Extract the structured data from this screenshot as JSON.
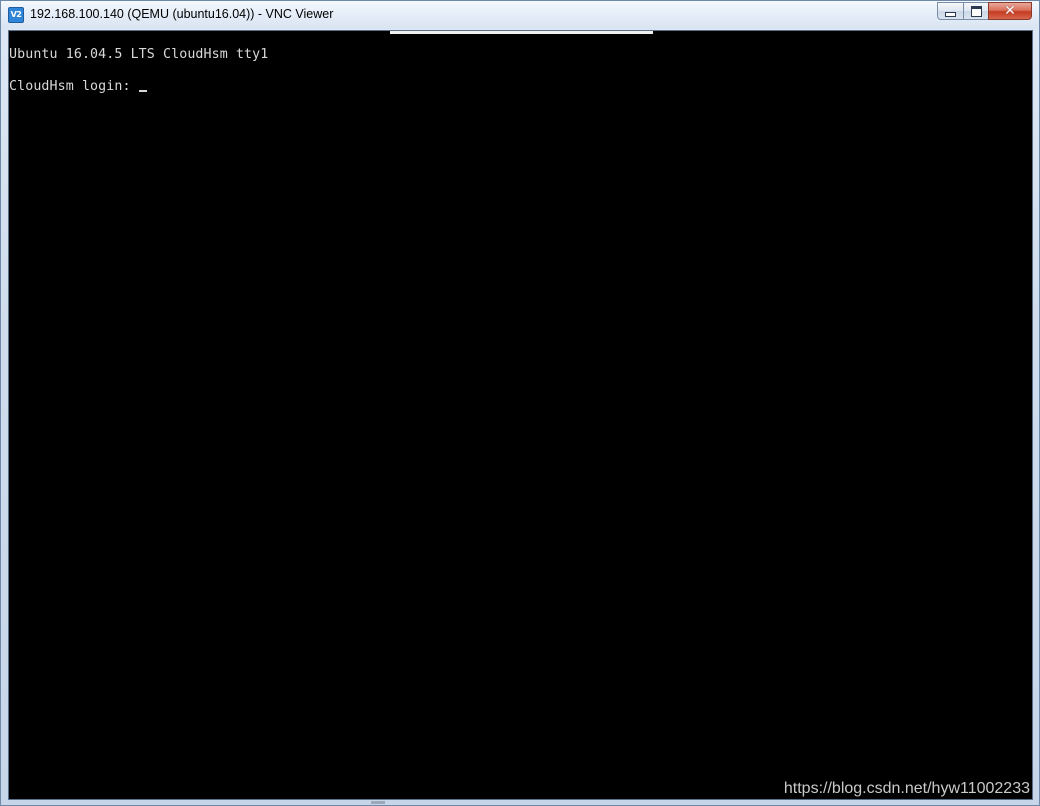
{
  "window": {
    "title": "192.168.100.140 (QEMU (ubuntu16.04)) - VNC Viewer",
    "app_icon": "vnc-viewer-icon",
    "app_icon_text": "V2",
    "controls": {
      "minimize_icon": "minimize-icon",
      "maximize_icon": "restore-icon",
      "close_icon": "close-icon",
      "close_glyph": "✕"
    }
  },
  "console": {
    "banner": "Ubuntu 16.04.5 LTS CloudHsm tty1",
    "login_prompt": "CloudHsm login:"
  },
  "watermark": "https://blog.csdn.net/hyw11002233",
  "colors": {
    "screen_background": "#000000",
    "console_text": "#d8d8d8",
    "close_button": "#c43b21"
  }
}
